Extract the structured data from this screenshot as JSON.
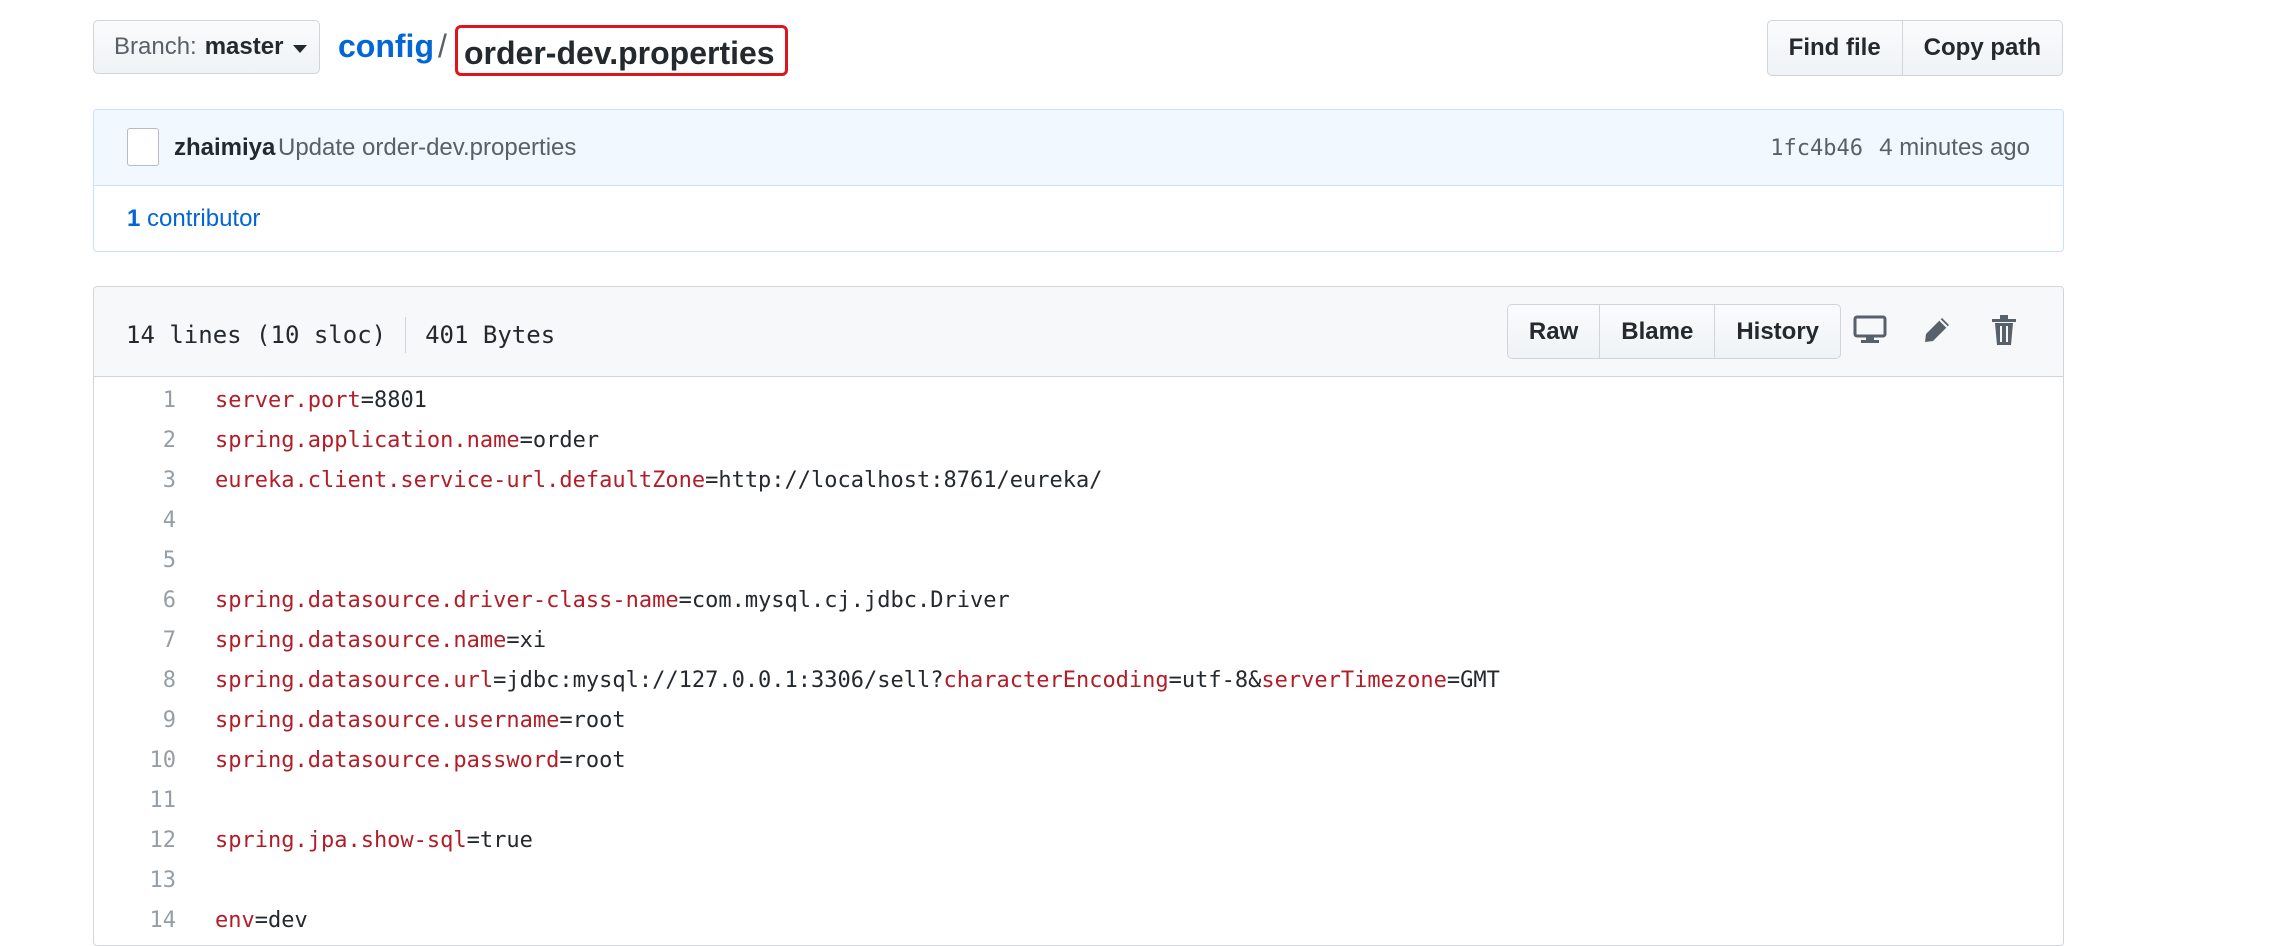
{
  "branch": {
    "label": "Branch:",
    "name": "master"
  },
  "breadcrumb": {
    "root": "config",
    "separator": "/",
    "file": "order-dev.properties"
  },
  "header_buttons": {
    "find_file": "Find file",
    "copy_path": "Copy path"
  },
  "commit": {
    "author": "zhaimiya",
    "message": "Update order-dev.properties",
    "sha": "1fc4b46",
    "age": "4 minutes ago",
    "contributors_count": "1",
    "contributors_label": "contributor"
  },
  "file": {
    "lines_info": "14 lines (10 sloc)",
    "size": "401 Bytes",
    "actions": {
      "raw": "Raw",
      "blame": "Blame",
      "history": "History"
    },
    "icons": [
      "desktop-icon",
      "pencil-icon",
      "trash-icon"
    ]
  },
  "code_lines": [
    {
      "n": "1",
      "key": "server.port",
      "rest": "=8801"
    },
    {
      "n": "2",
      "key": "spring.application.name",
      "rest": "=order"
    },
    {
      "n": "3",
      "key": "eureka.client.service-url.defaultZone",
      "rest": "=http://localhost:8761/eureka/"
    },
    {
      "n": "4",
      "key": "",
      "rest": ""
    },
    {
      "n": "5",
      "key": "",
      "rest": ""
    },
    {
      "n": "6",
      "key": "spring.datasource.driver-class-name",
      "rest": "=com.mysql.cj.jdbc.Driver"
    },
    {
      "n": "7",
      "key": "spring.datasource.name",
      "rest": "=xi"
    },
    {
      "n": "8",
      "key": "spring.datasource.url",
      "rest": "=jdbc:mysql://127.0.0.1:3306/sell?",
      "key2": "characterEncoding",
      "rest2": "=utf-8&",
      "key3": "serverTimezone",
      "rest3": "=GMT"
    },
    {
      "n": "9",
      "key": "spring.datasource.username",
      "rest": "=root"
    },
    {
      "n": "10",
      "key": "spring.datasource.password",
      "rest": "=root"
    },
    {
      "n": "11",
      "key": "",
      "rest": ""
    },
    {
      "n": "12",
      "key": "spring.jpa.show-sql",
      "rest": "=true"
    },
    {
      "n": "13",
      "key": "",
      "rest": ""
    },
    {
      "n": "14",
      "key": "env",
      "rest": "=dev"
    }
  ],
  "colors": {
    "link": "#0366d6",
    "highlight_border": "#e0141d",
    "key": "#b31d28"
  }
}
